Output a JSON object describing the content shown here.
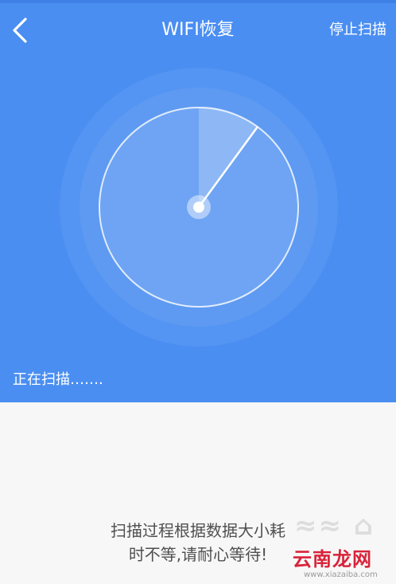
{
  "header": {
    "title": "WIFI恢复",
    "stop_label": "停止扫描",
    "back_icon": "chevron-left-icon"
  },
  "radar": {
    "icon": "radar-scan-icon"
  },
  "status": {
    "text": "正在扫描……."
  },
  "hint": {
    "line1": "扫描过程根据数据大小耗",
    "line2": "时不等,请耐心等待!"
  },
  "watermark": {
    "logo_text": "云南龙网",
    "url_text": "www.xiazaiba.com"
  },
  "colors": {
    "primary": "#4a8ef2",
    "background": "#f7f7f7",
    "text_dark": "#4f4f4f",
    "watermark_red": "#d8243b"
  }
}
